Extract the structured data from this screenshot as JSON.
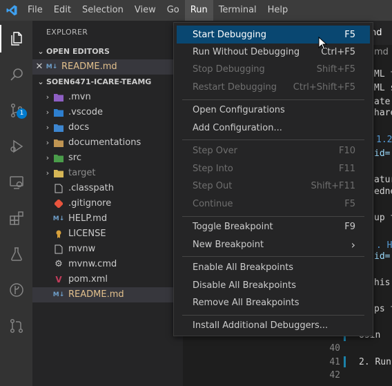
{
  "menubar": {
    "items": [
      "File",
      "Edit",
      "Selection",
      "View",
      "Go",
      "Run",
      "Terminal",
      "Help"
    ]
  },
  "activitybar": {
    "icons": [
      "files-icon",
      "search-icon",
      "source-control-icon",
      "run-debug-icon",
      "remote-explorer-icon",
      "extensions-icon",
      "testing-icon",
      "git-graph-icon",
      "pull-request-icon"
    ],
    "scm_badge": "1"
  },
  "sidebar": {
    "title": "EXPLORER",
    "open_editors_header": "OPEN EDITORS",
    "open_editors": [
      {
        "name": "README.md"
      }
    ],
    "project_header": "SOEN6471-ICARE-TEAMG",
    "tree": [
      {
        "name": ".mvn",
        "kind": "folder"
      },
      {
        "name": ".vscode",
        "kind": "folder"
      },
      {
        "name": "docs",
        "kind": "folder"
      },
      {
        "name": "documentations",
        "kind": "folder"
      },
      {
        "name": "src",
        "kind": "folder"
      },
      {
        "name": "target",
        "kind": "folder"
      },
      {
        "name": ".classpath",
        "kind": "file"
      },
      {
        "name": ".gitignore",
        "kind": "file"
      },
      {
        "name": "HELP.md",
        "kind": "file"
      },
      {
        "name": "LICENSE",
        "kind": "file"
      },
      {
        "name": "mvnw",
        "kind": "file"
      },
      {
        "name": "mvnw.cmd",
        "kind": "file"
      },
      {
        "name": "pom.xml",
        "kind": "file"
      },
      {
        "name": "README.md",
        "kind": "file"
      }
    ]
  },
  "editor": {
    "tab_fragment": "nd",
    "tab_fragment_2": "md",
    "code_fragments": [
      "ML t",
      "ML s",
      "ate",
      "hare",
      "1.2",
      "id=",
      "atur",
      "edne",
      "up t",
      ". He",
      "id=",
      "his",
      "ps t",
      "Usin",
      "2. Run"
    ],
    "line_numbers": [
      "40",
      "41",
      "42"
    ]
  },
  "run_menu": {
    "items": [
      {
        "label": "Start Debugging",
        "key": "F5",
        "state": "highlight"
      },
      {
        "label": "Run Without Debugging",
        "key": "Ctrl+F5",
        "state": "enabled"
      },
      {
        "label": "Stop Debugging",
        "key": "Shift+F5",
        "state": "disabled"
      },
      {
        "label": "Restart Debugging",
        "key": "Ctrl+Shift+F5",
        "state": "disabled"
      },
      {
        "label": "Open Configurations",
        "key": "",
        "state": "enabled"
      },
      {
        "label": "Add Configuration...",
        "key": "",
        "state": "enabled"
      },
      {
        "label": "Step Over",
        "key": "F10",
        "state": "disabled"
      },
      {
        "label": "Step Into",
        "key": "F11",
        "state": "disabled"
      },
      {
        "label": "Step Out",
        "key": "Shift+F11",
        "state": "disabled"
      },
      {
        "label": "Continue",
        "key": "F5",
        "state": "disabled"
      },
      {
        "label": "Toggle Breakpoint",
        "key": "F9",
        "state": "enabled"
      },
      {
        "label": "New Breakpoint",
        "key": "",
        "state": "submenu"
      },
      {
        "label": "Enable All Breakpoints",
        "key": "",
        "state": "enabled"
      },
      {
        "label": "Disable All Breakpoints",
        "key": "",
        "state": "enabled"
      },
      {
        "label": "Remove All Breakpoints",
        "key": "",
        "state": "enabled"
      },
      {
        "label": "Install Additional Debuggers...",
        "key": "",
        "state": "enabled"
      }
    ]
  },
  "colors": {
    "accent": "#007acc",
    "menu_highlight": "#094771",
    "titlebar": "#3c3c3c"
  }
}
